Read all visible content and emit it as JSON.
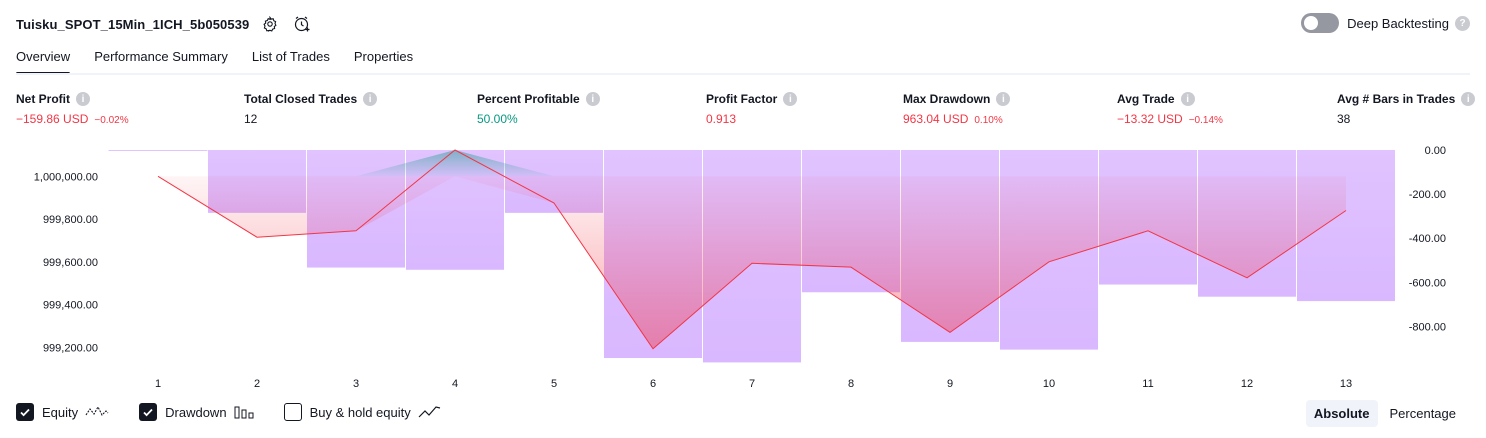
{
  "header": {
    "title": "Tuisku_SPOT_15Min_1ICH_5b050539",
    "icons": [
      "settings-icon",
      "alert-add-icon"
    ]
  },
  "deep_backtesting": {
    "label": "Deep Backtesting",
    "enabled": false,
    "help": "?"
  },
  "tabs": [
    {
      "label": "Overview",
      "active": true
    },
    {
      "label": "Performance Summary",
      "active": false
    },
    {
      "label": "List of Trades",
      "active": false
    },
    {
      "label": "Properties",
      "active": false
    }
  ],
  "stats": {
    "net_profit": {
      "label": "Net Profit",
      "value": "−159.86 USD",
      "pct": "−0.02%"
    },
    "total_closed_trades": {
      "label": "Total Closed Trades",
      "value": "12"
    },
    "percent_profitable": {
      "label": "Percent Profitable",
      "value": "50.00%"
    },
    "profit_factor": {
      "label": "Profit Factor",
      "value": "0.913"
    },
    "max_drawdown": {
      "label": "Max Drawdown",
      "value": "963.04 USD",
      "pct": "0.10%"
    },
    "avg_trade": {
      "label": "Avg Trade",
      "value": "−13.32 USD",
      "pct": "−0.14%"
    },
    "avg_bars": {
      "label": "Avg # Bars in Trades",
      "value": "38"
    }
  },
  "colors": {
    "loss": "#f23645",
    "profit": "#089981",
    "drawdown_bar": "#e1c3ff",
    "equity_line": "#f23645"
  },
  "chart_data": {
    "type": "line+bar",
    "x": [
      1,
      2,
      3,
      4,
      5,
      6,
      7,
      8,
      9,
      10,
      11,
      12,
      13
    ],
    "series": [
      {
        "name": "Equity",
        "axis": "left",
        "values": [
          1000000.0,
          999715.0,
          999745.0,
          1000123.0,
          999875.0,
          999193.0,
          999593.0,
          999575.0,
          999270.0,
          999600.0,
          999745.0,
          999525.0,
          999840.0
        ]
      },
      {
        "name": "Drawdown",
        "axis": "right",
        "type": "bar",
        "values": [
          0,
          -285,
          -533,
          -543,
          -285,
          -943,
          -963,
          -645,
          -870,
          -905,
          -610,
          -665,
          -685
        ]
      }
    ],
    "left_ticks": [
      "1,000,000.00",
      "999,800.00",
      "999,600.00",
      "999,400.00",
      "999,200.00"
    ],
    "left_tick_values": [
      1000000,
      999800,
      999600,
      999400,
      999200
    ],
    "right_ticks": [
      "0.00",
      "-200.00",
      "-400.00",
      "-600.00",
      "-800.00"
    ],
    "right_tick_values": [
      0,
      -200,
      -400,
      -600,
      -800
    ],
    "ylim_left": [
      999150,
      1000123
    ],
    "ylim_right": [
      -943,
      0
    ]
  },
  "footer": {
    "checkboxes": [
      {
        "label": "Equity",
        "checked": true,
        "icon": "equity-line-icon"
      },
      {
        "label": "Drawdown",
        "checked": true,
        "icon": "drawdown-bars-icon"
      },
      {
        "label": "Buy & hold equity",
        "checked": false,
        "icon": "buy-hold-line-icon"
      }
    ],
    "modes": [
      {
        "label": "Absolute",
        "active": true
      },
      {
        "label": "Percentage",
        "active": false
      }
    ]
  }
}
